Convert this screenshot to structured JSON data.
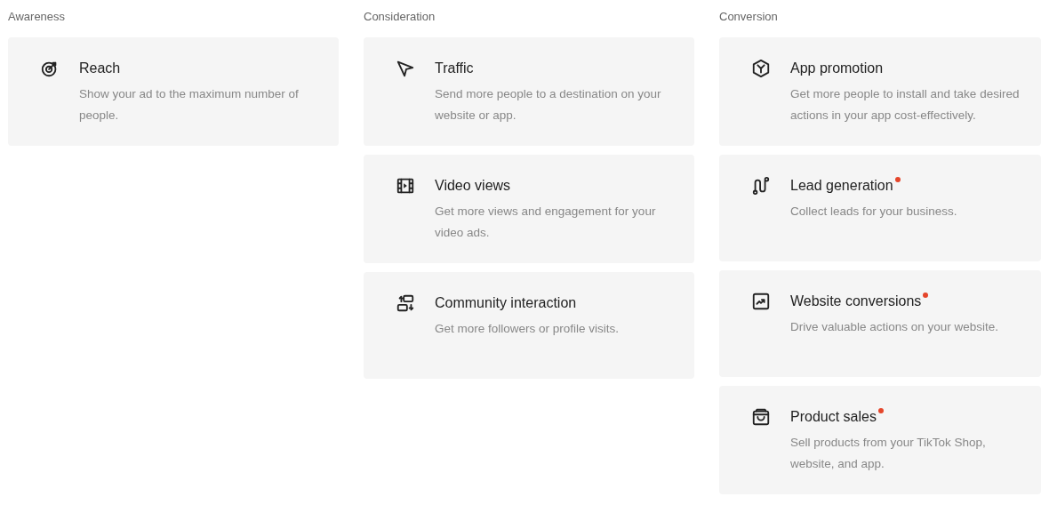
{
  "columns": [
    {
      "heading": "Awareness",
      "cards": [
        {
          "title": "Reach",
          "description": "Show your ad to the maximum number of people.",
          "new_dot": false
        }
      ]
    },
    {
      "heading": "Consideration",
      "cards": [
        {
          "title": "Traffic",
          "description": "Send more people to a destination on your website or app.",
          "new_dot": false
        },
        {
          "title": "Video views",
          "description": "Get more views and engagement for your video ads.",
          "new_dot": false
        },
        {
          "title": "Community interaction",
          "description": "Get more followers or profile visits.",
          "new_dot": false
        }
      ]
    },
    {
      "heading": "Conversion",
      "cards": [
        {
          "title": "App promotion",
          "description": "Get more people to install and take desired actions in your app cost-effectively.",
          "new_dot": false
        },
        {
          "title": "Lead generation",
          "description": "Collect leads for your business.",
          "new_dot": true
        },
        {
          "title": "Website conversions",
          "description": "Drive valuable actions on your website.",
          "new_dot": true
        },
        {
          "title": "Product sales",
          "description": "Sell products from your TikTok Shop, website, and app.",
          "new_dot": true
        }
      ]
    }
  ]
}
